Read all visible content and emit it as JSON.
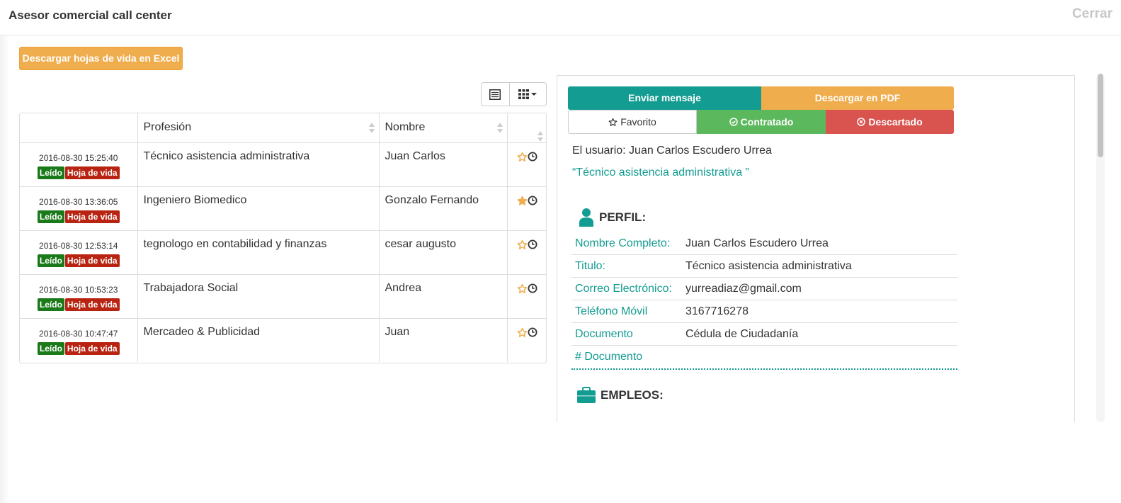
{
  "header": {
    "title": "Asesor comercial call center",
    "close_label": "Cerrar"
  },
  "actions": {
    "excel_label": "Descargar hojas de vida en Excel"
  },
  "table": {
    "columns": [
      "",
      "Profesión",
      "Nombre",
      ""
    ],
    "rows": [
      {
        "date": "2016-08-30 15:25:40",
        "read": "Leído",
        "cv": "Hoja de vida",
        "profession": "Técnico asistencia administrativa",
        "name": "Juan Carlos",
        "favorite": false
      },
      {
        "date": "2016-08-30 13:36:05",
        "read": "Leído",
        "cv": "Hoja de vida",
        "profession": "Ingeniero Biomedico",
        "name": "Gonzalo Fernando",
        "favorite": true
      },
      {
        "date": "2016-08-30 12:53:14",
        "read": "Leído",
        "cv": "Hoja de vida",
        "profession": "tegnologo en contabilidad y finanzas",
        "name": "cesar augusto",
        "favorite": false
      },
      {
        "date": "2016-08-30 10:53:23",
        "read": "Leído",
        "cv": "Hoja de vida",
        "profession": "Trabajadora Social",
        "name": "Andrea",
        "favorite": false
      },
      {
        "date": "2016-08-30 10:47:47",
        "read": "Leído",
        "cv": "Hoja de vida",
        "profession": "Mercadeo & Publicidad",
        "name": "Juan",
        "favorite": false
      }
    ]
  },
  "detail": {
    "send_message": "Enviar mensaje",
    "download_pdf": "Descargar en PDF",
    "favorite": "Favorito",
    "hired": "Contratado",
    "discarded": "Descartado",
    "user_line": "El usuario: Juan Carlos Escudero Urrea",
    "quote_line": "“Técnico asistencia administrativa ”",
    "profile_heading": "PERFIL:",
    "profile_rows": [
      {
        "label": "Nombre Completo:",
        "value": "Juan Carlos Escudero Urrea"
      },
      {
        "label": "Titulo:",
        "value": "Técnico asistencia administrativa"
      },
      {
        "label": "Correo Electrónico:",
        "value": "yurreadiaz@gmail.com"
      },
      {
        "label": "Teléfono Móvil",
        "value": "3167716278"
      },
      {
        "label": "Documento",
        "value": "Cédula de Ciudadanía"
      },
      {
        "label": "# Documento",
        "value": ""
      }
    ],
    "jobs_heading": "EMPLEOS:"
  },
  "colors": {
    "teal": "#139c91",
    "orange": "#f0ad4e",
    "green": "#5cb85c",
    "red": "#d9534f",
    "badge_green": "#1a7a1a",
    "badge_red": "#b82411",
    "star": "#f0ad4e"
  }
}
